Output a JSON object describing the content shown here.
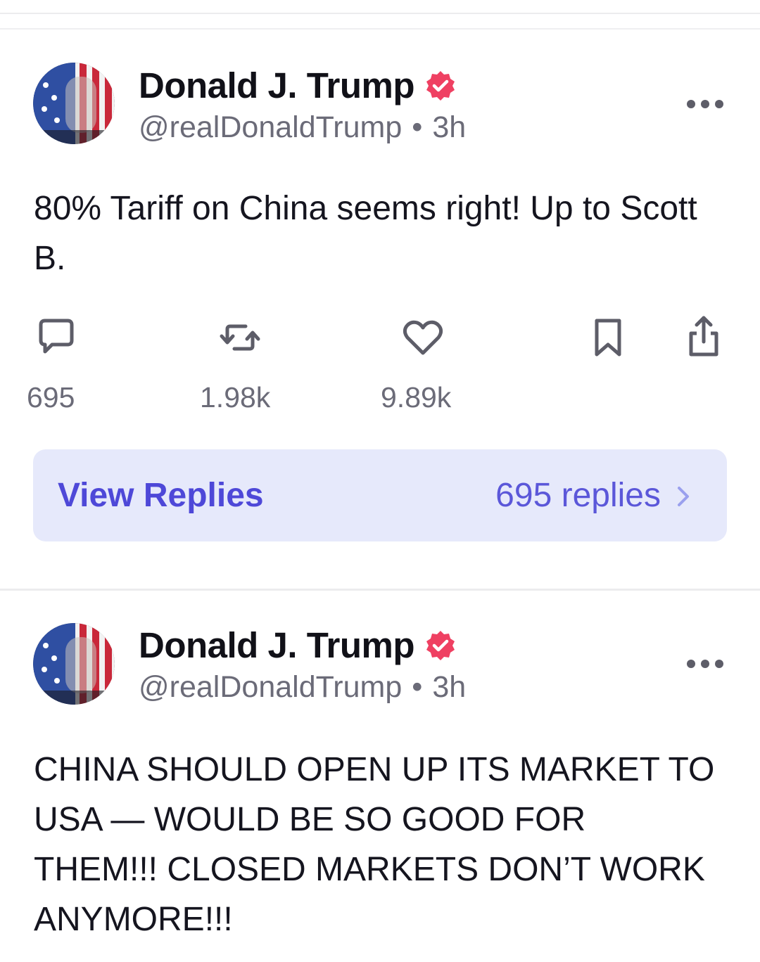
{
  "posts": [
    {
      "author": {
        "name": "Donald J. Trump",
        "handle": "@realDonaldTrump",
        "separator": "•",
        "time": "3h",
        "verified": true
      },
      "text": "80% Tariff on China seems right! Up to Scott B.",
      "actions": {
        "replies_count": "695",
        "reposts_count": "1.98k",
        "likes_count": "9.89k"
      },
      "view_replies": {
        "label": "View Replies",
        "count_label": "695 replies"
      }
    },
    {
      "author": {
        "name": "Donald J. Trump",
        "handle": "@realDonaldTrump",
        "separator": "•",
        "time": "3h",
        "verified": true
      },
      "text": "CHINA SHOULD OPEN UP ITS MARKET TO USA — WOULD BE SO GOOD FOR THEM!!! CLOSED MARKETS DON’T WORK ANYMORE!!!"
    }
  ],
  "colors": {
    "accent": "#4e48d8",
    "verified_badge": "#ef4062",
    "view_replies_bg": "#e6e9fb",
    "muted_text": "#6b6b78"
  },
  "icons": [
    "verified-badge-icon",
    "more-icon",
    "reply-icon",
    "repost-icon",
    "like-icon",
    "bookmark-icon",
    "share-icon",
    "chevron-right-icon"
  ]
}
